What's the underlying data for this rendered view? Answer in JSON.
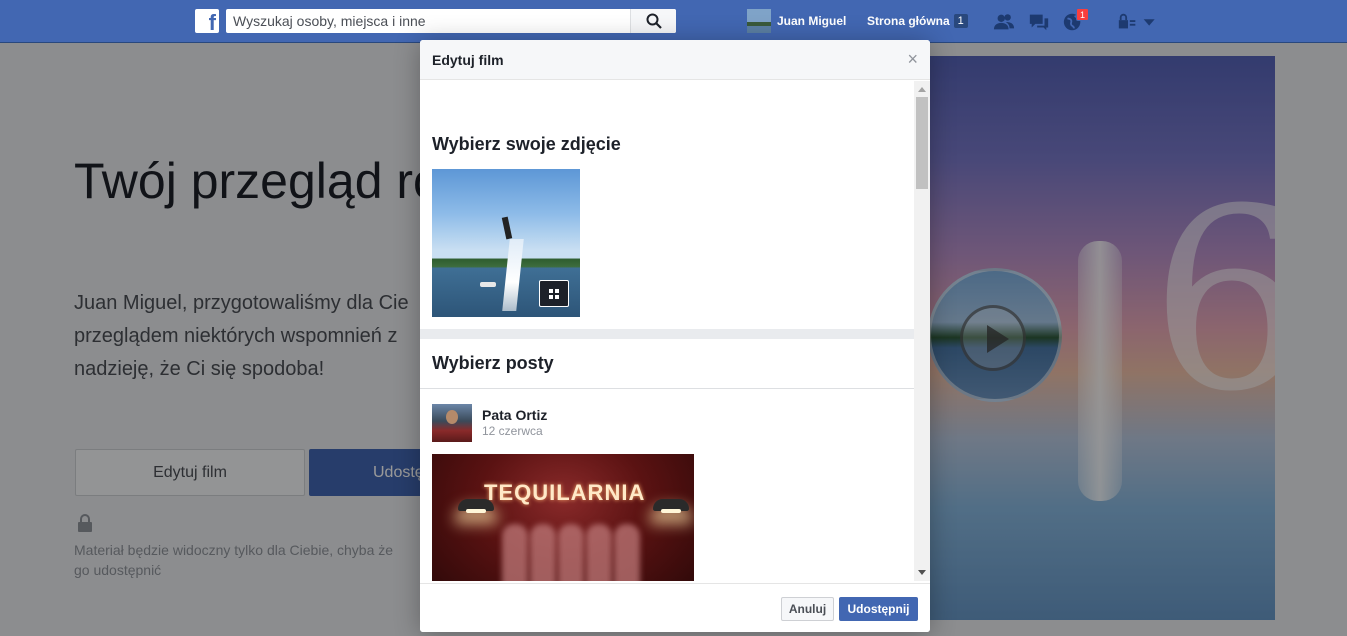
{
  "topbar": {
    "search_placeholder": "Wyszukaj osoby, miejsca i inne",
    "profile_name": "Juan Miguel",
    "home_label": "Strona główna",
    "home_count": "1",
    "notifications_count": "1",
    "accent_color": "#4267b2"
  },
  "background_page": {
    "title": "Twój przegląd ro",
    "description_lines": [
      "Juan Miguel, przygotowaliśmy dla Cie",
      "przeglądem niektórych wspomnień z",
      "nadzieję, że Ci się spodoba!"
    ],
    "edit_button": "Edytuj film",
    "share_button": "Udostę",
    "privacy_lines": [
      "Materiał będzie widoczny tylko dla Ciebie, chyba że",
      "go udostępnić"
    ],
    "video_year_digit": "6"
  },
  "dialog": {
    "title": "Edytuj film",
    "close_symbol": "×",
    "photo_section_title": "Wybierz swoje zdjęcie",
    "posts_section_title": "Wybierz posty",
    "post": {
      "author": "Pata Ortiz",
      "date": "12 czerwca",
      "photo_sign": "TEQUILARNIA"
    },
    "cancel_button": "Anuluj",
    "share_button": "Udostępnij"
  }
}
